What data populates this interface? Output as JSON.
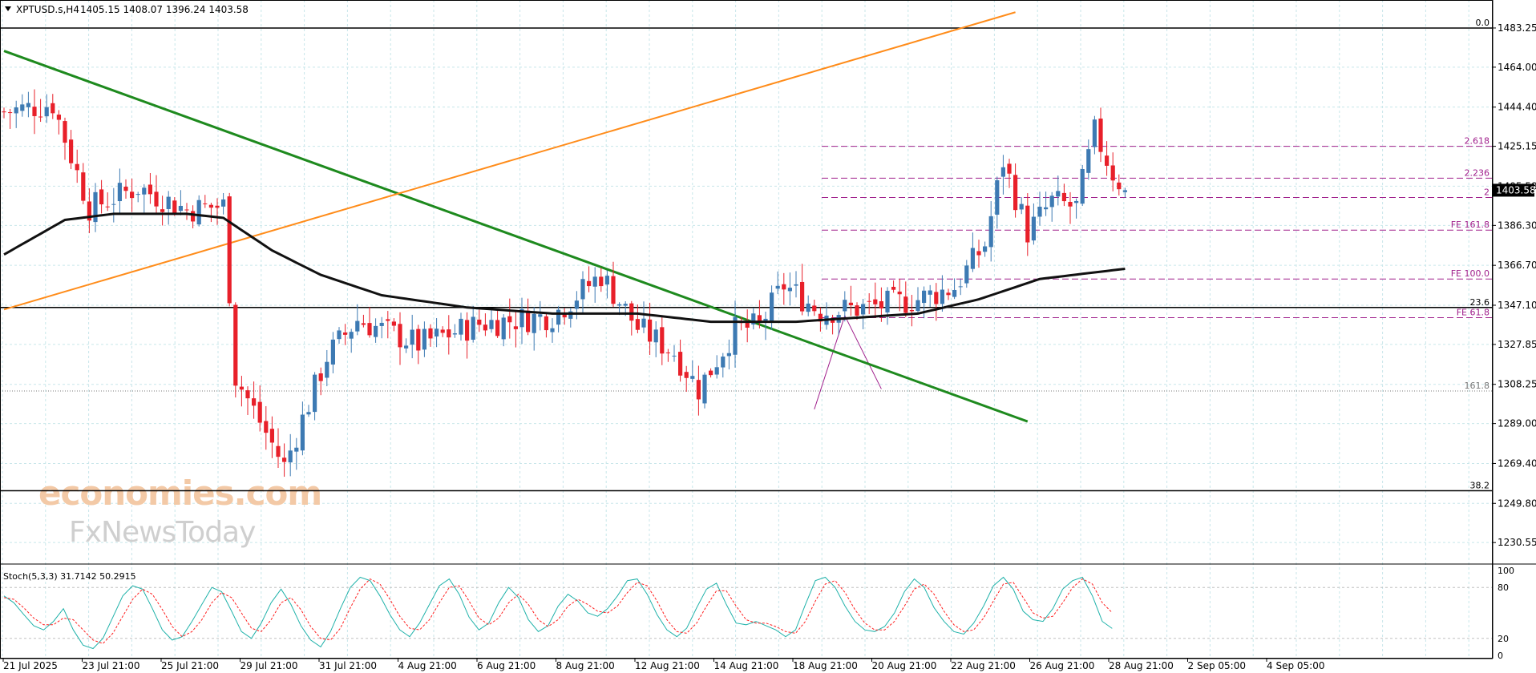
{
  "header": {
    "symbol": "XPTUSD.s,H4",
    "ohlc": "1405.15 1408.07 1396.24 1403.58"
  },
  "watermark": {
    "line1": "economies.com",
    "line2": "FxNewsToday"
  },
  "colors": {
    "background": "#ffffff",
    "grid": "#c8e6ea",
    "bull": "#3d7ab3",
    "bear": "#e8202a",
    "ma": "#111111",
    "downtrend": "#1e8a1e",
    "uptrend": "#ff8c1a",
    "fib": "#a0208c",
    "stoch_main": "#20b2aa",
    "stoch_signal": "#ff2020",
    "price_tag": "#000000"
  },
  "chart_data": {
    "type": "candlestick",
    "price_axis": {
      "min": 1220,
      "max": 1497,
      "ticks": [
        "1483.25",
        "1464.00",
        "1444.40",
        "1425.15",
        "1405.58",
        "1386.30",
        "1366.70",
        "1347.10",
        "1327.85",
        "1308.25",
        "1289.00",
        "1269.40",
        "1249.80",
        "1230.55"
      ],
      "current": "1403.58"
    },
    "time_axis": [
      "21 Jul 2025",
      "23 Jul 21:00",
      "25 Jul 21:00",
      "29 Jul 21:00",
      "31 Jul 21:00",
      "4 Aug 21:00",
      "6 Aug 21:00",
      "8 Aug 21:00",
      "12 Aug 21:00",
      "14 Aug 21:00",
      "18 Aug 21:00",
      "20 Aug 21:00",
      "22 Aug 21:00",
      "26 Aug 21:00",
      "28 Aug 21:00",
      "2 Sep 05:00",
      "4 Sep 05:00"
    ],
    "candle_count": 215,
    "key_closes": [
      {
        "bar": 0,
        "price": 1442
      },
      {
        "bar": 8,
        "price": 1446
      },
      {
        "bar": 14,
        "price": 1395
      },
      {
        "bar": 22,
        "price": 1405
      },
      {
        "bar": 30,
        "price": 1394
      },
      {
        "bar": 36,
        "price": 1396
      },
      {
        "bar": 38,
        "price": 1312
      },
      {
        "bar": 46,
        "price": 1268
      },
      {
        "bar": 53,
        "price": 1322
      },
      {
        "bar": 58,
        "price": 1340
      },
      {
        "bar": 68,
        "price": 1328
      },
      {
        "bar": 78,
        "price": 1338
      },
      {
        "bar": 90,
        "price": 1342
      },
      {
        "bar": 98,
        "price": 1362
      },
      {
        "bar": 104,
        "price": 1336
      },
      {
        "bar": 110,
        "price": 1324
      },
      {
        "bar": 114,
        "price": 1306
      },
      {
        "bar": 120,
        "price": 1335
      },
      {
        "bar": 124,
        "price": 1337
      },
      {
        "bar": 128,
        "price": 1357
      },
      {
        "bar": 134,
        "price": 1344
      },
      {
        "bar": 142,
        "price": 1346
      },
      {
        "bar": 150,
        "price": 1350
      },
      {
        "bar": 156,
        "price": 1356
      },
      {
        "bar": 161,
        "price": 1377
      },
      {
        "bar": 164,
        "price": 1418
      },
      {
        "bar": 168,
        "price": 1383
      },
      {
        "bar": 172,
        "price": 1398
      },
      {
        "bar": 176,
        "price": 1395
      },
      {
        "bar": 179,
        "price": 1432
      },
      {
        "bar": 182,
        "price": 1412
      },
      {
        "bar": 184,
        "price": 1403.58
      }
    ],
    "moving_average": [
      {
        "bar": 0,
        "price": 1372
      },
      {
        "bar": 10,
        "price": 1389
      },
      {
        "bar": 18,
        "price": 1392
      },
      {
        "bar": 30,
        "price": 1392
      },
      {
        "bar": 36,
        "price": 1390
      },
      {
        "bar": 44,
        "price": 1374
      },
      {
        "bar": 52,
        "price": 1362
      },
      {
        "bar": 62,
        "price": 1352
      },
      {
        "bar": 76,
        "price": 1346
      },
      {
        "bar": 90,
        "price": 1343
      },
      {
        "bar": 104,
        "price": 1343
      },
      {
        "bar": 116,
        "price": 1339
      },
      {
        "bar": 130,
        "price": 1339
      },
      {
        "bar": 150,
        "price": 1343
      },
      {
        "bar": 160,
        "price": 1350
      },
      {
        "bar": 170,
        "price": 1360
      },
      {
        "bar": 184,
        "price": 1365
      }
    ],
    "trendlines": [
      {
        "name": "downtrend",
        "from": {
          "bar": 0,
          "price": 1472
        },
        "to": {
          "bar": 168,
          "price": 1290
        }
      },
      {
        "name": "uptrend",
        "from": {
          "bar": 0,
          "price": 1345
        },
        "to": {
          "bar": 166,
          "price": 1491
        }
      }
    ],
    "horizontal_levels": [
      {
        "price": 1483.25,
        "label": "0.0",
        "style": "solid"
      },
      {
        "price": 1346,
        "label": "23.6",
        "style": "solid"
      },
      {
        "price": 1305,
        "label": "161.8",
        "style": "dotted"
      },
      {
        "price": 1256,
        "label": "38.2",
        "style": "solid"
      }
    ],
    "fib_extension": [
      {
        "price": 1425.15,
        "label": "2.618"
      },
      {
        "price": 1409.5,
        "label": "2.236"
      },
      {
        "price": 1400,
        "label": "2"
      },
      {
        "price": 1384,
        "label": "FE 161.8"
      },
      {
        "price": 1360,
        "label": "FE 100.0"
      },
      {
        "price": 1341,
        "label": "FE 61.8"
      }
    ],
    "stochastic": {
      "label": "Stoch(5,3,3) 31.7142 50.2915",
      "levels": [
        "100",
        "80",
        "20",
        "0"
      ],
      "main": [
        70,
        62,
        48,
        35,
        30,
        40,
        55,
        30,
        12,
        8,
        20,
        45,
        70,
        82,
        78,
        55,
        30,
        18,
        22,
        40,
        60,
        80,
        75,
        52,
        28,
        20,
        38,
        62,
        78,
        60,
        35,
        18,
        10,
        28,
        55,
        80,
        92,
        88,
        70,
        48,
        30,
        22,
        38,
        60,
        82,
        90,
        72,
        45,
        30,
        38,
        62,
        80,
        68,
        42,
        28,
        35,
        58,
        72,
        64,
        50,
        46,
        55,
        70,
        88,
        90,
        72,
        48,
        30,
        22,
        32,
        56,
        78,
        85,
        60,
        38,
        36,
        40,
        35,
        30,
        22,
        30,
        60,
        88,
        92,
        80,
        58,
        40,
        30,
        28,
        34,
        50,
        75,
        90,
        80,
        56,
        40,
        28,
        25,
        38,
        58,
        82,
        92,
        78,
        52,
        42,
        40,
        55,
        78,
        88,
        92,
        70,
        40,
        31.7
      ],
      "signal": [
        68,
        66,
        56,
        44,
        36,
        36,
        44,
        42,
        30,
        18,
        14,
        26,
        46,
        66,
        78,
        72,
        54,
        34,
        22,
        28,
        42,
        62,
        74,
        68,
        50,
        32,
        28,
        42,
        62,
        68,
        54,
        34,
        20,
        18,
        32,
        56,
        78,
        90,
        84,
        66,
        46,
        32,
        30,
        42,
        62,
        80,
        82,
        64,
        44,
        36,
        44,
        62,
        72,
        60,
        42,
        34,
        42,
        58,
        66,
        60,
        52,
        50,
        58,
        74,
        86,
        82,
        64,
        42,
        28,
        26,
        38,
        58,
        76,
        76,
        58,
        42,
        38,
        38,
        34,
        28,
        26,
        40,
        64,
        84,
        88,
        74,
        54,
        38,
        30,
        30,
        40,
        58,
        78,
        84,
        72,
        52,
        36,
        28,
        30,
        44,
        64,
        84,
        86,
        68,
        50,
        44,
        46,
        62,
        80,
        90,
        84,
        62,
        50.3
      ]
    }
  }
}
